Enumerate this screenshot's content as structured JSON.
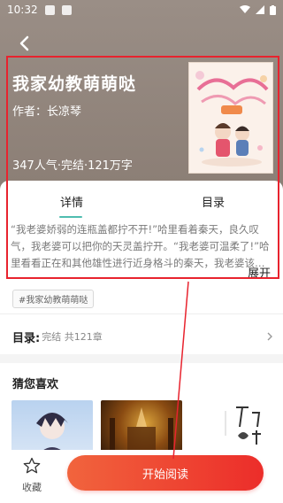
{
  "status_bar": {
    "time": "10:32"
  },
  "nav": {
    "back_icon": "back-arrow-icon"
  },
  "book": {
    "title": "我家幼教萌萌哒",
    "author": "作者：长凉琴",
    "stats": "347人气·完结·121万字"
  },
  "tabs": [
    {
      "label": "详情",
      "active": true
    },
    {
      "label": "目录",
      "active": false
    }
  ],
  "synopsis": "“我老婆娇弱的连瓶盖都拧不开!”哈里看着秦天，良久叹气，我老婆可以把你的天灵盖拧开。“我老婆可温柔了!”哈里看看正在和其他雄性进行近身格斗的秦天，我老婆该…",
  "expand_label": "展开",
  "tag": "#我家幼教萌萌哒",
  "toc": {
    "label": "目录:",
    "status": "完结 共121章"
  },
  "recommend": {
    "title": "猜您喜欢"
  },
  "bottom": {
    "favorite_label": "收藏",
    "read_label": "开始阅读"
  },
  "colors": {
    "accent_red": "#e8232e",
    "button_start": "#f1643d",
    "button_end": "#ec2d2a",
    "tab_underline": "#4fbdb0"
  }
}
